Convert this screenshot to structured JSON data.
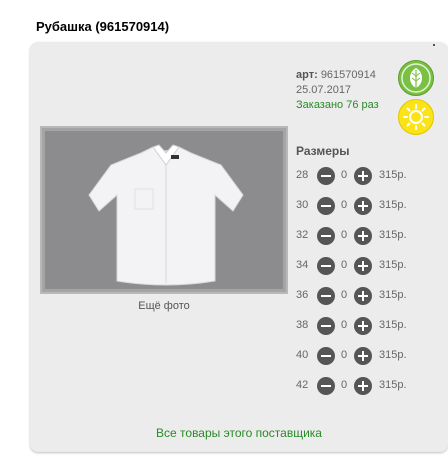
{
  "product": {
    "title": "Рубашка (961570914)",
    "art_label": "арт:",
    "art_value": "961570914",
    "date": "25.07.2017",
    "ordered": "Заказано 76 раз",
    "more_photos": "Ещё фото"
  },
  "badges": {
    "leaf_icon": "leaf-icon",
    "sun_icon": "sun-icon",
    "leaf_color": "#7ac143",
    "sun_color": "#fbe317"
  },
  "sizes": {
    "title": "Размеры",
    "rows": [
      {
        "size": "28",
        "qty": "0",
        "price": "315р."
      },
      {
        "size": "30",
        "qty": "0",
        "price": "315р."
      },
      {
        "size": "32",
        "qty": "0",
        "price": "315р."
      },
      {
        "size": "34",
        "qty": "0",
        "price": "315р."
      },
      {
        "size": "36",
        "qty": "0",
        "price": "315р."
      },
      {
        "size": "38",
        "qty": "0",
        "price": "315р."
      },
      {
        "size": "40",
        "qty": "0",
        "price": "315р."
      },
      {
        "size": "42",
        "qty": "0",
        "price": "315р."
      }
    ]
  },
  "footer": {
    "supplier_link": "Все товары этого поставщика"
  }
}
